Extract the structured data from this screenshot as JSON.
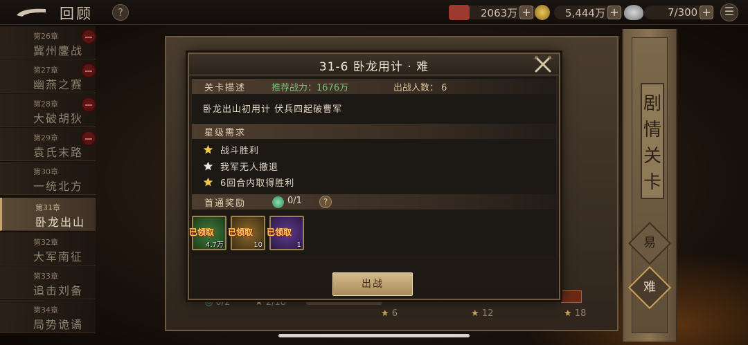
{
  "topbar": {
    "title": "回顾",
    "help": "?",
    "resources": [
      {
        "name": "silver",
        "value": "2063万",
        "color": "#b8443a"
      },
      {
        "name": "gold",
        "value": "5,444万",
        "color": "#c9a23a"
      },
      {
        "name": "stamina",
        "value": "7/300",
        "color": "#9a9a9a"
      }
    ],
    "plus": "+"
  },
  "chapters": [
    {
      "num": "第26章",
      "name": "冀州鏖战",
      "badge": true
    },
    {
      "num": "第27章",
      "name": "幽燕之赛",
      "badge": true
    },
    {
      "num": "第28章",
      "name": "大破胡狄",
      "badge": true
    },
    {
      "num": "第29章",
      "name": "袁氏末路",
      "badge": true
    },
    {
      "num": "第30章",
      "name": "一统北方",
      "badge": false
    },
    {
      "num": "第31章",
      "name": "卧龙出山",
      "badge": false,
      "active": true
    },
    {
      "num": "第32章",
      "name": "大军南征",
      "badge": false
    },
    {
      "num": "第33章",
      "name": "追击刘备",
      "badge": false
    },
    {
      "num": "第34章",
      "name": "局势诡谲",
      "badge": false
    }
  ],
  "map": {
    "gem_progress": "0/2",
    "star_progress": "2/18",
    "milestones": [
      "6",
      "12",
      "18"
    ]
  },
  "scroll": {
    "title_chars": [
      "剧",
      "情",
      "关",
      "卡"
    ],
    "difficulty_easy": "易",
    "difficulty_hard": "难"
  },
  "dialog": {
    "title": "31-6 卧龙用计 · 难",
    "stage_desc_label": "关卡描述",
    "recommended_power": "推荐战力：1676万",
    "team_count": "出战人数： 6",
    "description": "卧龙出山初用计 伏兵四起破曹军",
    "star_req_label": "星级需求",
    "conditions": [
      {
        "text": "战斗胜利",
        "achieved": true
      },
      {
        "text": "我军无人撤退",
        "achieved": false
      },
      {
        "text": "6回合内取得胜利",
        "achieved": true
      }
    ],
    "first_clear_label": "首通奖励",
    "first_clear_count": "0/1",
    "help": "?",
    "rewards": [
      {
        "claimed_label": "已领取",
        "qty": "4.7万",
        "rarity": "green"
      },
      {
        "claimed_label": "已领取",
        "qty": "10",
        "rarity": "gold"
      },
      {
        "claimed_label": "已领取",
        "qty": "1",
        "rarity": "purple"
      }
    ],
    "fight_button": "出战"
  },
  "colors": {
    "star_gold": "#f2c84b",
    "star_silver": "#e6e6e6",
    "power_green": "#7dc07a"
  }
}
